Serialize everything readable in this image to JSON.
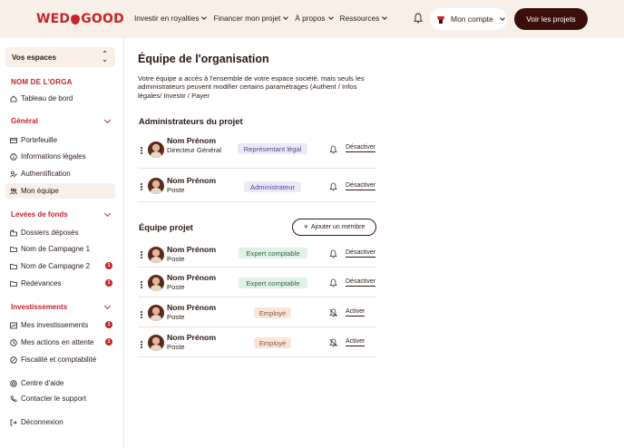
{
  "header": {
    "logo": "WEDOGOOD",
    "nav": [
      {
        "label": "Investir en royalties"
      },
      {
        "label": "Financer mon projet"
      },
      {
        "label": "À propos"
      },
      {
        "label": "Ressources"
      }
    ],
    "account_label": "Mon compte",
    "cta_label": "Voir les projets"
  },
  "sidebar": {
    "space_select": "Vos espaces",
    "org_name": "NOM DE L'ORGA",
    "dashboard": "Tableau de bord",
    "general": {
      "title": "Général",
      "items": [
        "Portefeuille",
        "Informations légales",
        "Authentification",
        "Mon équipe"
      ]
    },
    "fundraising": {
      "title": "Levées de fonds",
      "items": [
        {
          "label": "Dossiers déposés",
          "badge": ""
        },
        {
          "label": "Nom de Campagne 1",
          "badge": ""
        },
        {
          "label": "Nom de Campagne 2",
          "badge": "1"
        },
        {
          "label": "Redevances",
          "badge": "1"
        }
      ]
    },
    "investments": {
      "title": "Investissements",
      "items": [
        {
          "label": "Mes investissements",
          "badge": "1"
        },
        {
          "label": "Mes actions en attente",
          "badge": "1"
        },
        {
          "label": "Fiscalité et comptabilité",
          "badge": ""
        }
      ]
    },
    "help": "Centre d'aide",
    "support": "Contacter le support",
    "logout": "Déconnexion"
  },
  "main": {
    "title": "Équipe de l'organisation",
    "description": "Votre équipe a accès à l'ensemble de votre espace société, mais seuls les administrateurs peuvent modifier certains paramétrages (Authent / Infos légales/ Investir / Payer",
    "admins": {
      "title": "Administrateurs du projet",
      "members": [
        {
          "name": "Nom Prénom",
          "role": "Directeur Général",
          "tag": "Représentant légal",
          "action": "Désactiver"
        },
        {
          "name": "Nom Prénom",
          "role": "Poste",
          "tag": "Administrateur",
          "action": "Désactiver"
        }
      ]
    },
    "team": {
      "title": "Équipe projet",
      "add_label": "Ajouter un membre",
      "members": [
        {
          "name": "Nom Prénom",
          "role": "Poste",
          "tag": "Expert comptable",
          "action": "Désactiver"
        },
        {
          "name": "Nom Prénom",
          "role": "Poste",
          "tag": "Expert comptable",
          "action": "Désactiver"
        },
        {
          "name": "Nom Prénom",
          "role": "Poste",
          "tag": "Employé",
          "action": "Activer"
        },
        {
          "name": "Nom Prénom",
          "role": "Poste",
          "tag": "Employé",
          "action": "Activer"
        }
      ]
    }
  },
  "colors": {
    "brand": "#c4242a",
    "dark": "#3a0f0a",
    "cream": "#f7efe8"
  }
}
